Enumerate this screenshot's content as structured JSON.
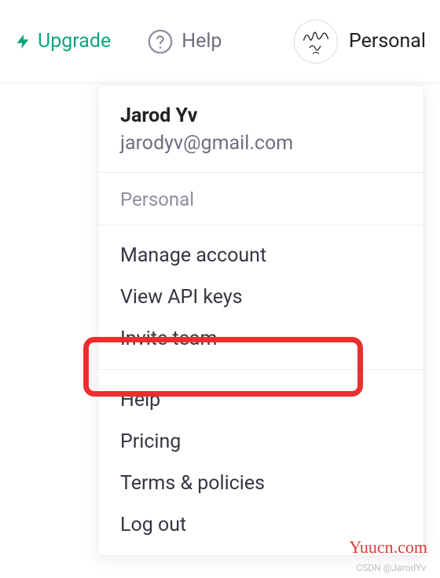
{
  "topbar": {
    "upgrade": "Upgrade",
    "help": "Help",
    "account": "Personal"
  },
  "user": {
    "name": "Jarod Yv",
    "email": "jarodyv@gmail.com"
  },
  "dropdown": {
    "section_label": "Personal",
    "group1": {
      "manage": "Manage account",
      "api_keys": "View API keys",
      "invite": "Invite team"
    },
    "group2": {
      "help": "Help",
      "pricing": "Pricing",
      "terms": "Terms & policies",
      "logout": "Log out"
    }
  },
  "watermark": {
    "site": "Yuucn.com",
    "credit": "CSDN @JarodYv"
  }
}
